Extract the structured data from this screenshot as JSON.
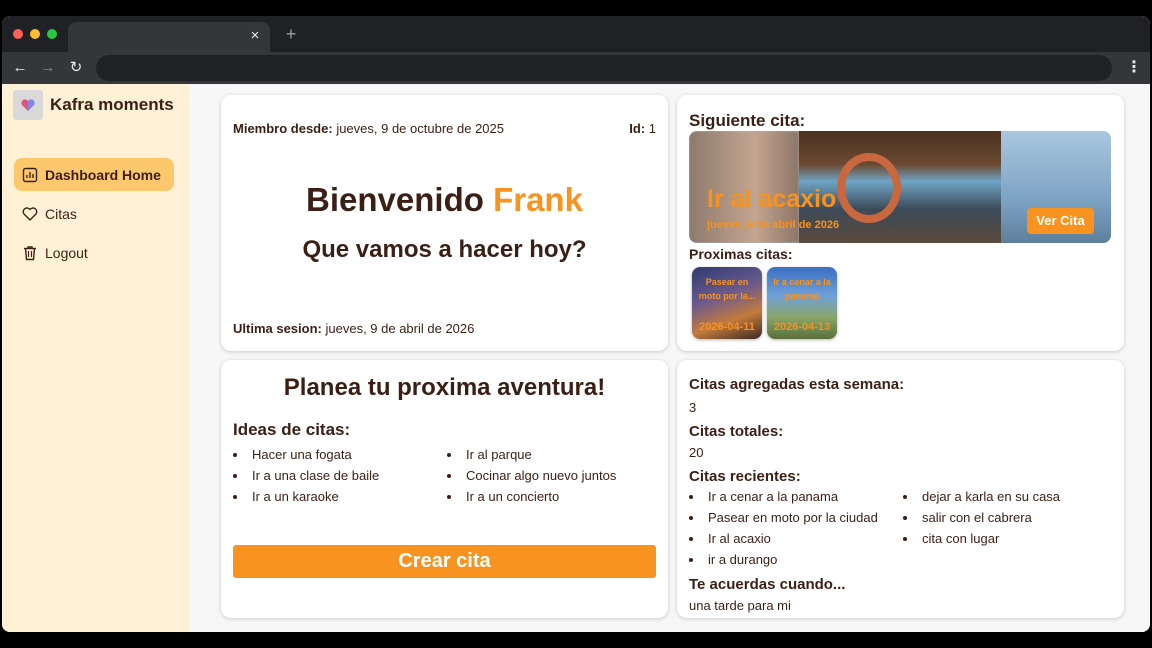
{
  "browser": {
    "tab_close": "×",
    "new_tab": "+",
    "back": "←",
    "forward": "→",
    "reload": "↻",
    "menu": "⋮"
  },
  "sidebar": {
    "brand": "Kafra moments",
    "items": [
      {
        "label": "Dashboard Home",
        "icon": "bar-chart-icon",
        "active": true
      },
      {
        "label": "Citas",
        "icon": "heart-icon",
        "active": false
      },
      {
        "label": "Logout",
        "icon": "trash-icon",
        "active": false
      }
    ]
  },
  "profile": {
    "member_label": "Miembro desde:",
    "member_value": "jueves, 9 de octubre de 2025",
    "id_label": "Id:",
    "id_value": "1",
    "welcome": "Bienvenido",
    "name": "Frank",
    "subtitle": "Que vamos a hacer hoy?",
    "last_session_label": "Ultima sesion:",
    "last_session_value": "jueves, 9 de abril de 2026"
  },
  "next_date": {
    "label": "Siguiente cita:",
    "title": "Ir al acaxio",
    "date": "jueves, 9 de abril de 2026",
    "button": "Ver Cita",
    "upcoming_label": "Proximas citas:",
    "upcoming": [
      {
        "title": "Pasear en moto por la...",
        "date": "2026-04-11"
      },
      {
        "title": "Ir a cenar a la panama",
        "date": "2026-04-13"
      }
    ]
  },
  "plan": {
    "title": "Planea tu proxima aventura!",
    "ideas_label": "Ideas de citas:",
    "ideas_col1": [
      "Hacer una fogata",
      "Ir a una clase de baile",
      "Ir a un karaoke"
    ],
    "ideas_col2": [
      "Ir al parque",
      "Cocinar algo nuevo juntos",
      "Ir a un concierto"
    ],
    "button": "Crear cita"
  },
  "stats": {
    "week_label": "Citas agregadas esta semana:",
    "week_value": "3",
    "total_label": "Citas totales:",
    "total_value": "20",
    "recent_label": "Citas recientes:",
    "recent_col1": [
      "Ir a cenar a la panama",
      "Pasear en moto por la ciudad",
      "Ir al acaxio",
      "ir a durango"
    ],
    "recent_col2": [
      "dejar a karla en su casa",
      "salir con el cabrera",
      "cita con lugar"
    ],
    "remember_label": "Te acuerdas cuando...",
    "remember_value": "una tarde para mi"
  },
  "colors": {
    "accent": "#f7931e",
    "sidebar_bg": "#fff1d6",
    "active_item": "#fdc86b",
    "text": "#3b1f14"
  }
}
